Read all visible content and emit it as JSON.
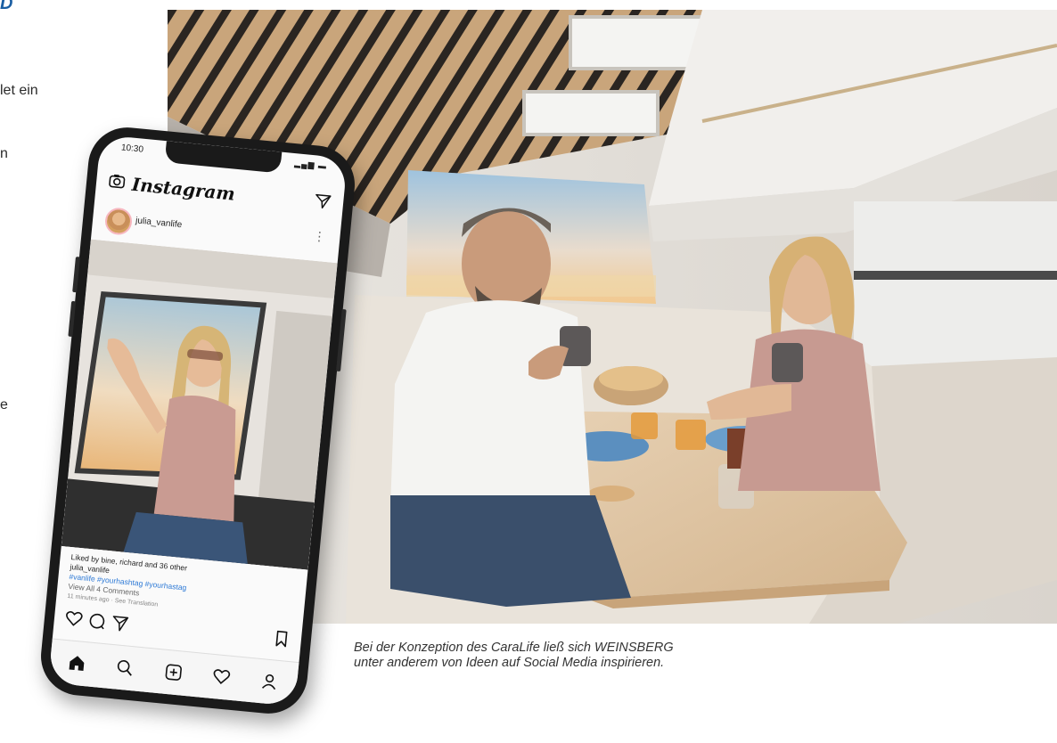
{
  "page": {
    "corner_mark": "D",
    "fragments": [
      "let ein",
      "n",
      "e"
    ]
  },
  "caption": "Bei der Konzeption des CaraLife ließ sich WEINSBERG unter anderem von Ideen auf Social Media inspirieren.",
  "phone": {
    "status_time": "10:30",
    "app_name": "Instagram",
    "username": "julia_vanlife",
    "liked_by": "Liked by bine, richard and 36 other",
    "caption_user": "julia_vanlife",
    "hashtags": "#vanlife #yourhashtag #yourhastag",
    "comments": "View All 4 Comments",
    "time_ago": "11 minutes ago · See Translation"
  },
  "icons": {
    "camera": "camera-icon",
    "send": "send-icon",
    "like": "heart-icon",
    "comment": "comment-icon",
    "share": "share-icon",
    "bookmark": "bookmark-icon",
    "home": "home-icon",
    "search": "search-icon",
    "add": "add-icon",
    "activity": "heart-icon",
    "profile": "profile-icon"
  },
  "colors": {
    "accent_blue": "#1b5fa3",
    "hashtag_blue": "#2e7ad6"
  }
}
